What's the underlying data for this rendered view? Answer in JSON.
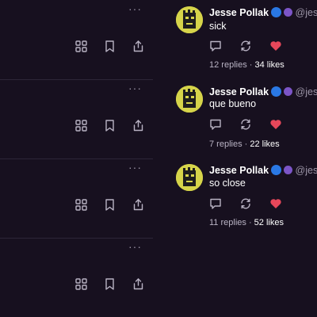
{
  "left_rows": [
    {
      "more_label": "···"
    },
    {
      "more_label": "···"
    },
    {
      "more_label": "···"
    },
    {
      "more_label": "···"
    }
  ],
  "posts": [
    {
      "author": "Jesse Pollak",
      "handle": "@jes",
      "text": "sick",
      "replies": "12 replies",
      "sep": " · ",
      "likes": "34 likes"
    },
    {
      "author": "Jesse Pollak",
      "handle": "@jes",
      "text": "que bueno",
      "replies": "7 replies",
      "sep": " · ",
      "likes": "22 likes"
    },
    {
      "author": "Jesse Pollak",
      "handle": "@jes",
      "text": "so close",
      "replies": "11 replies",
      "sep": " · ",
      "likes": "52 likes"
    }
  ],
  "colors": {
    "background": "#17101f",
    "heart": "#e6475a",
    "badge_blue": "#2a78e4",
    "badge_purple": "#7c55c7"
  },
  "icons": {
    "row_actions": [
      "grid-icon",
      "bookmark-icon",
      "share-icon"
    ],
    "post_actions": [
      "reply-icon",
      "recast-icon",
      "heart-icon"
    ]
  }
}
